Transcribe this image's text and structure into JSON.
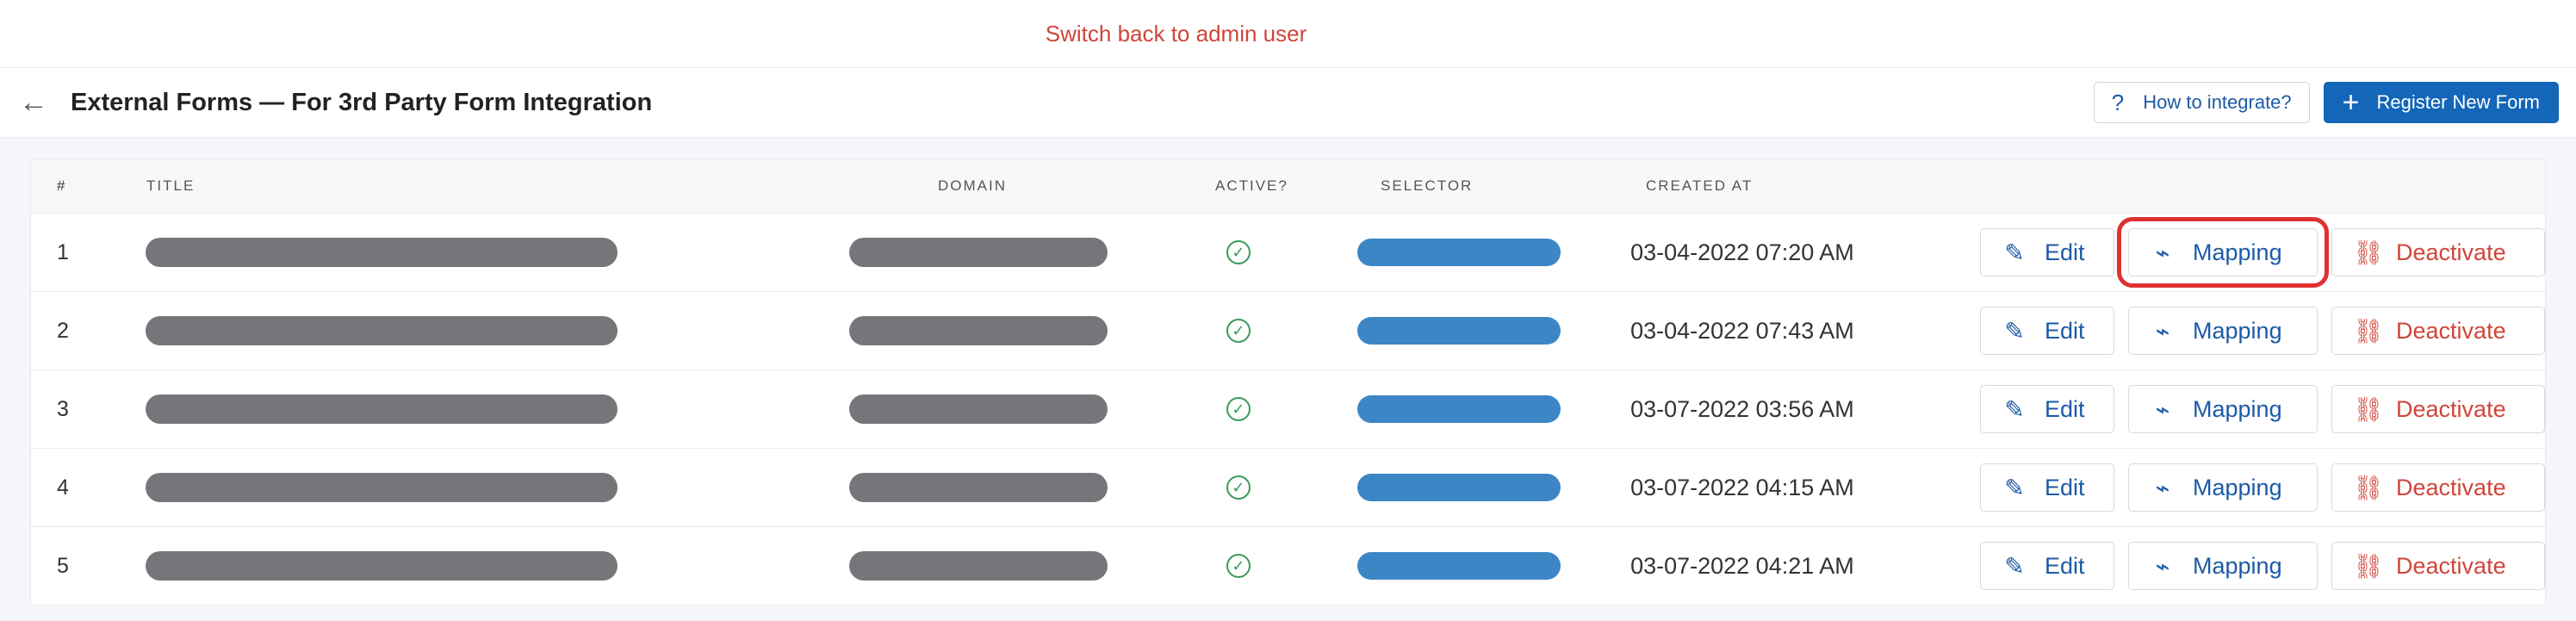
{
  "topbar": {
    "switch_link": "Switch back to admin user"
  },
  "header": {
    "title": "External Forms — For 3rd Party Form Integration",
    "how_to_label": "How to integrate?",
    "register_label": "Register New Form"
  },
  "table": {
    "headers": {
      "num": "#",
      "title": "Title",
      "domain": "Domain",
      "active": "Active?",
      "selector": "Selector",
      "created": "Created At"
    },
    "rows": [
      {
        "num": "1",
        "created": "03-04-2022 07:20 AM"
      },
      {
        "num": "2",
        "created": "03-04-2022 07:43 AM"
      },
      {
        "num": "3",
        "created": "03-07-2022 03:56 AM"
      },
      {
        "num": "4",
        "created": "03-07-2022 04:15 AM"
      },
      {
        "num": "5",
        "created": "03-07-2022 04:21 AM"
      }
    ],
    "actions": {
      "edit": "Edit",
      "mapping": "Mapping",
      "deactivate": "Deactivate"
    }
  },
  "icons": {
    "back": "arrow-left-icon",
    "help": "question-icon",
    "add": "plus-icon",
    "active": "check-circle-icon",
    "edit": "edit-icon",
    "mapping": "plug-icon",
    "deactivate": "unlink-icon"
  },
  "colors": {
    "primary": "#1366b8",
    "danger": "#d0453a",
    "success": "#3a9a5a",
    "highlight": "#e03131"
  }
}
